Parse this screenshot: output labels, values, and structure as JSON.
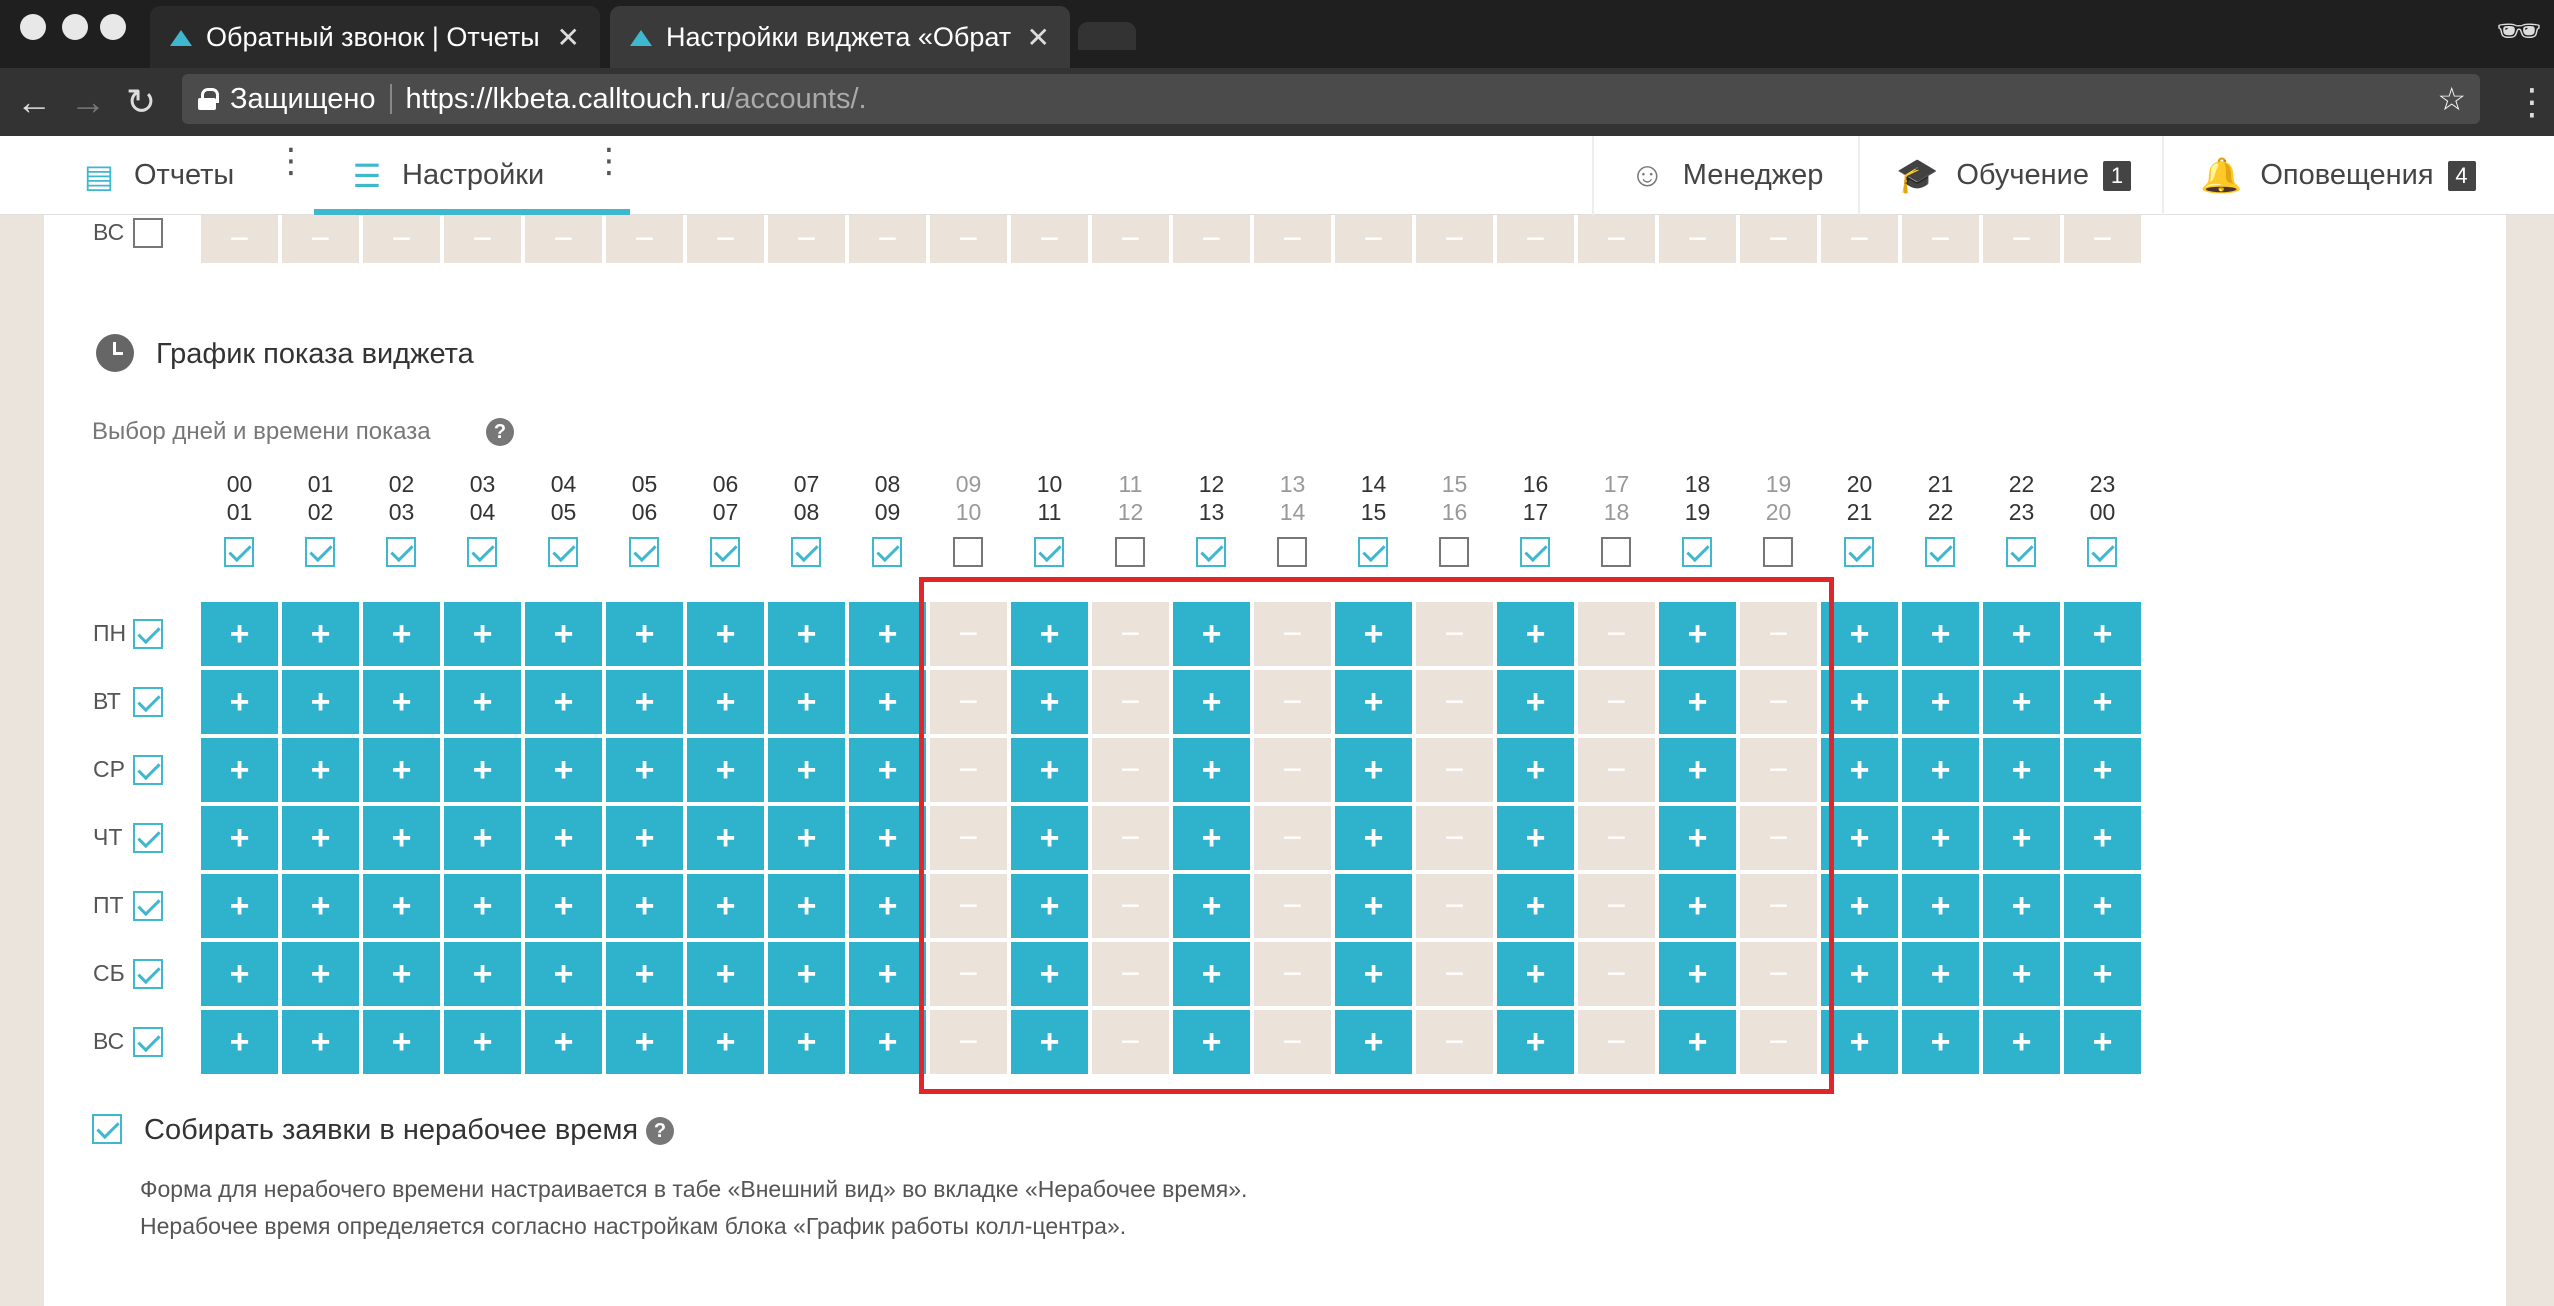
{
  "browser": {
    "tabs": [
      {
        "title": "Обратный звонок | Отчеты | C",
        "active": false
      },
      {
        "title": "Настройки виджета «Обратн",
        "active": true
      }
    ],
    "address": {
      "secure_label": "Защищено",
      "url_host": "https://lkbeta.calltouch.ru",
      "url_path": "/accounts/."
    }
  },
  "header": {
    "reports_label": "Отчеты",
    "settings_label": "Настройки",
    "manager_label": "Менеджер",
    "learning_label": "Обучение",
    "learning_badge": "1",
    "notifications_label": "Оповещения",
    "notifications_badge": "4"
  },
  "top_row": {
    "day": "ВС",
    "symbol": "−"
  },
  "schedule": {
    "title": "График показа виджета",
    "subtitle": "Выбор дней и времени показа",
    "help": "?",
    "on_symbol": "+",
    "off_symbol": "−",
    "hours": [
      {
        "from": "00",
        "to": "01",
        "on": true
      },
      {
        "from": "01",
        "to": "02",
        "on": true
      },
      {
        "from": "02",
        "to": "03",
        "on": true
      },
      {
        "from": "03",
        "to": "04",
        "on": true
      },
      {
        "from": "04",
        "to": "05",
        "on": true
      },
      {
        "from": "05",
        "to": "06",
        "on": true
      },
      {
        "from": "06",
        "to": "07",
        "on": true
      },
      {
        "from": "07",
        "to": "08",
        "on": true
      },
      {
        "from": "08",
        "to": "09",
        "on": true
      },
      {
        "from": "09",
        "to": "10",
        "on": false
      },
      {
        "from": "10",
        "to": "11",
        "on": true
      },
      {
        "from": "11",
        "to": "12",
        "on": false
      },
      {
        "from": "12",
        "to": "13",
        "on": true
      },
      {
        "from": "13",
        "to": "14",
        "on": false
      },
      {
        "from": "14",
        "to": "15",
        "on": true
      },
      {
        "from": "15",
        "to": "16",
        "on": false
      },
      {
        "from": "16",
        "to": "17",
        "on": true
      },
      {
        "from": "17",
        "to": "18",
        "on": false
      },
      {
        "from": "18",
        "to": "19",
        "on": true
      },
      {
        "from": "19",
        "to": "20",
        "on": false
      },
      {
        "from": "20",
        "to": "21",
        "on": true
      },
      {
        "from": "21",
        "to": "22",
        "on": true
      },
      {
        "from": "22",
        "to": "23",
        "on": true
      },
      {
        "from": "23",
        "to": "00",
        "on": true
      }
    ],
    "days": [
      "ПН",
      "ВТ",
      "СР",
      "ЧТ",
      "ПТ",
      "СБ",
      "ВС"
    ]
  },
  "after_hours": {
    "label": "Собирать заявки в нерабочее время",
    "checked": true,
    "note_1": "Форма для нерабочего времени настраивается в табе «Внешний вид» во вкладке «Нерабочее время».",
    "note_2": "Нерабочее время определяется согласно настройкам блока «График работы колл-центра»."
  }
}
